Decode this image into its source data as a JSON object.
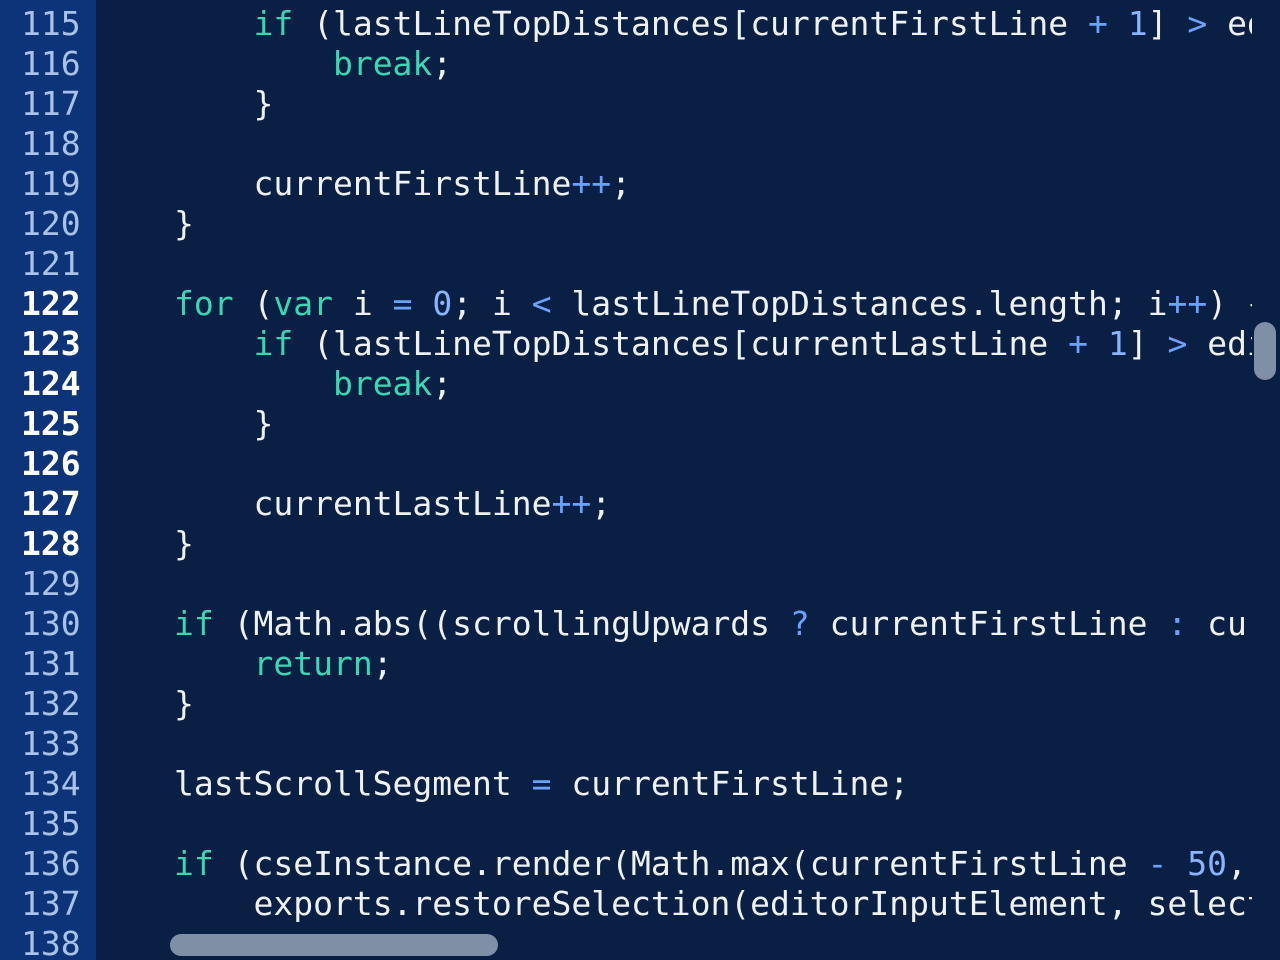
{
  "editor": {
    "active_lines": [
      "122",
      "123",
      "124",
      "125",
      "126",
      "127",
      "128"
    ],
    "lines": [
      {
        "num": "115",
        "indent": "    ",
        "tokens": [
          {
            "t": "if",
            "k": "kw"
          },
          {
            "t": " (lastLineTopDistances[currentFirstLine ",
            "k": "id"
          },
          {
            "t": "+",
            "k": "op"
          },
          {
            "t": " ",
            "k": "id"
          },
          {
            "t": "1",
            "k": "num"
          },
          {
            "t": "] ",
            "k": "id"
          },
          {
            "t": ">",
            "k": "op"
          },
          {
            "t": " ed",
            "k": "id"
          }
        ]
      },
      {
        "num": "116",
        "indent": "        ",
        "tokens": [
          {
            "t": "break",
            "k": "kw"
          },
          {
            "t": ";",
            "k": "punct"
          }
        ]
      },
      {
        "num": "117",
        "indent": "    ",
        "tokens": [
          {
            "t": "}",
            "k": "punct"
          }
        ]
      },
      {
        "num": "118",
        "indent": "",
        "tokens": []
      },
      {
        "num": "119",
        "indent": "    ",
        "tokens": [
          {
            "t": "currentFirstLine",
            "k": "id"
          },
          {
            "t": "++",
            "k": "op"
          },
          {
            "t": ";",
            "k": "punct"
          }
        ]
      },
      {
        "num": "120",
        "indent": "",
        "tokens": [
          {
            "t": "}",
            "k": "punct"
          }
        ]
      },
      {
        "num": "121",
        "indent": "",
        "tokens": []
      },
      {
        "num": "122",
        "indent": "",
        "tokens": [
          {
            "t": "for",
            "k": "kw"
          },
          {
            "t": " (",
            "k": "id"
          },
          {
            "t": "var",
            "k": "kw"
          },
          {
            "t": " i ",
            "k": "id"
          },
          {
            "t": "=",
            "k": "op"
          },
          {
            "t": " ",
            "k": "id"
          },
          {
            "t": "0",
            "k": "num"
          },
          {
            "t": "; i ",
            "k": "id"
          },
          {
            "t": "<",
            "k": "op"
          },
          {
            "t": " lastLineTopDistances.length; i",
            "k": "id"
          },
          {
            "t": "++",
            "k": "op"
          },
          {
            "t": ") {",
            "k": "id"
          }
        ]
      },
      {
        "num": "123",
        "indent": "    ",
        "tokens": [
          {
            "t": "if",
            "k": "kw"
          },
          {
            "t": " (lastLineTopDistances[currentLastLine ",
            "k": "id"
          },
          {
            "t": "+",
            "k": "op"
          },
          {
            "t": " ",
            "k": "id"
          },
          {
            "t": "1",
            "k": "num"
          },
          {
            "t": "] ",
            "k": "id"
          },
          {
            "t": ">",
            "k": "op"
          },
          {
            "t": " edi",
            "k": "id"
          }
        ]
      },
      {
        "num": "124",
        "indent": "        ",
        "tokens": [
          {
            "t": "break",
            "k": "kw"
          },
          {
            "t": ";",
            "k": "punct"
          }
        ]
      },
      {
        "num": "125",
        "indent": "    ",
        "tokens": [
          {
            "t": "}",
            "k": "punct"
          }
        ]
      },
      {
        "num": "126",
        "indent": "",
        "tokens": []
      },
      {
        "num": "127",
        "indent": "    ",
        "tokens": [
          {
            "t": "currentLastLine",
            "k": "id"
          },
          {
            "t": "++",
            "k": "op"
          },
          {
            "t": ";",
            "k": "punct"
          }
        ]
      },
      {
        "num": "128",
        "indent": "",
        "tokens": [
          {
            "t": "}",
            "k": "punct"
          }
        ]
      },
      {
        "num": "129",
        "indent": "",
        "tokens": []
      },
      {
        "num": "130",
        "indent": "",
        "tokens": [
          {
            "t": "if",
            "k": "kw"
          },
          {
            "t": " (Math.abs((scrollingUpwards ",
            "k": "id"
          },
          {
            "t": "?",
            "k": "op"
          },
          {
            "t": " currentFirstLine ",
            "k": "id"
          },
          {
            "t": ":",
            "k": "op"
          },
          {
            "t": " cur",
            "k": "id"
          }
        ]
      },
      {
        "num": "131",
        "indent": "    ",
        "tokens": [
          {
            "t": "return",
            "k": "kw"
          },
          {
            "t": ";",
            "k": "punct"
          }
        ]
      },
      {
        "num": "132",
        "indent": "",
        "tokens": [
          {
            "t": "}",
            "k": "punct"
          }
        ]
      },
      {
        "num": "133",
        "indent": "",
        "tokens": []
      },
      {
        "num": "134",
        "indent": "",
        "tokens": [
          {
            "t": "lastScrollSegment ",
            "k": "id"
          },
          {
            "t": "=",
            "k": "op"
          },
          {
            "t": " currentFirstLine;",
            "k": "id"
          }
        ]
      },
      {
        "num": "135",
        "indent": "",
        "tokens": []
      },
      {
        "num": "136",
        "indent": "",
        "tokens": [
          {
            "t": "if",
            "k": "kw"
          },
          {
            "t": " (cseInstance.render(Math.max(currentFirstLine ",
            "k": "id"
          },
          {
            "t": "-",
            "k": "op"
          },
          {
            "t": " ",
            "k": "id"
          },
          {
            "t": "50",
            "k": "num"
          },
          {
            "t": ",",
            "k": "id"
          }
        ]
      },
      {
        "num": "137",
        "indent": "    ",
        "tokens": [
          {
            "t": "exports.restoreSelection(editorInputElement, select",
            "k": "id"
          }
        ]
      },
      {
        "num": "138",
        "indent": "",
        "tokens": []
      }
    ]
  },
  "colors": {
    "background": "#0a1f44",
    "gutter": "#0d3478",
    "keyword": "#3ad7b2",
    "operator": "#6aa2ff",
    "number": "#8ab4ff",
    "text": "#eef2f7",
    "scrollbar": "#7f8fa6"
  }
}
